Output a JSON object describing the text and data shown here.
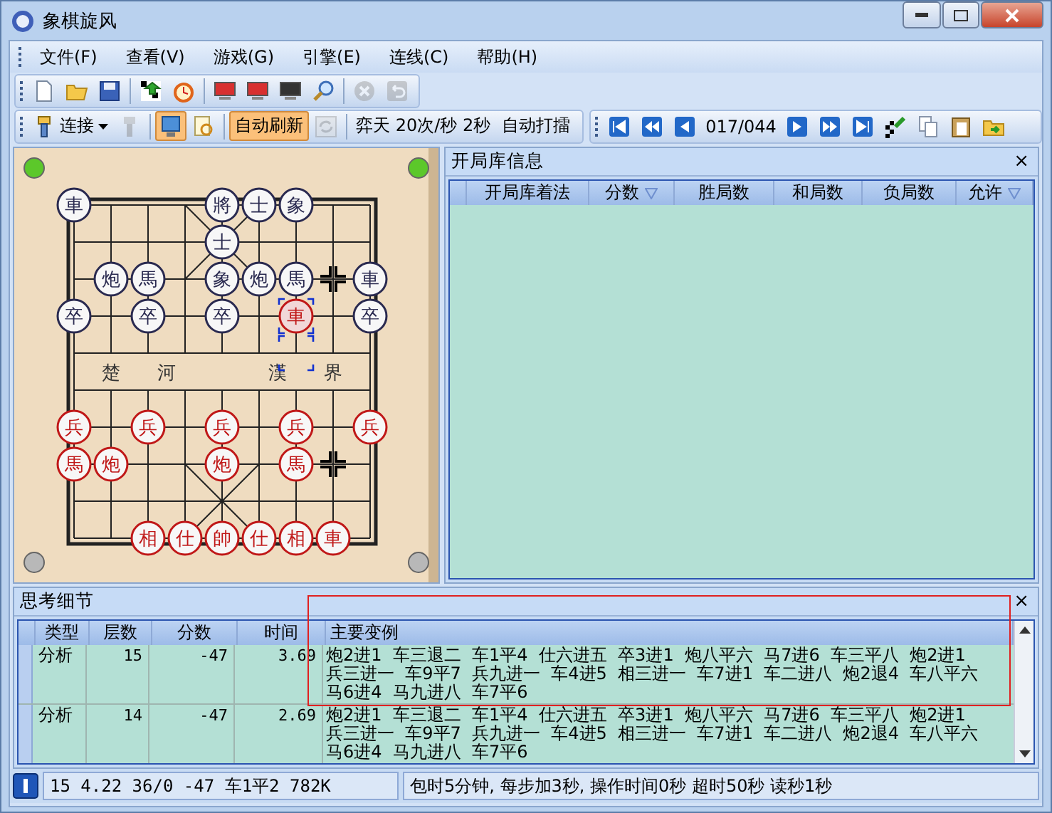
{
  "window": {
    "title": "象棋旋风"
  },
  "menu": [
    "文件(F)",
    "查看(V)",
    "游戏(G)",
    "引擎(E)",
    "连线(C)",
    "帮助(H)"
  ],
  "toolbar_file": [
    {
      "kind": "new",
      "disabled": false
    },
    {
      "kind": "open",
      "disabled": false
    },
    {
      "kind": "save",
      "disabled": false
    },
    {
      "kind": "sep"
    },
    {
      "kind": "swap",
      "disabled": false
    },
    {
      "kind": "clock",
      "disabled": false
    },
    {
      "kind": "sep"
    },
    {
      "kind": "redscreen",
      "disabled": false
    },
    {
      "kind": "redscreen",
      "disabled": false
    },
    {
      "kind": "darkscreen",
      "disabled": false
    },
    {
      "kind": "search",
      "disabled": false
    },
    {
      "kind": "sep"
    },
    {
      "kind": "stop",
      "disabled": true
    },
    {
      "kind": "undo",
      "disabled": true
    }
  ],
  "toolbar_connect": [
    {
      "kind": "plug",
      "disabled": false,
      "pressed": false,
      "label": "连接",
      "dropdown": true
    },
    {
      "kind": "tool",
      "disabled": true,
      "pressed": false
    },
    {
      "kind": "sep"
    },
    {
      "kind": "monitor",
      "disabled": false,
      "pressed": true
    },
    {
      "kind": "finder",
      "disabled": false,
      "pressed": false
    },
    {
      "kind": "sep"
    },
    {
      "kind": "text",
      "label": "自动刷新",
      "pressed": true
    },
    {
      "kind": "refresh",
      "disabled": true,
      "pressed": false
    },
    {
      "kind": "sep"
    },
    {
      "kind": "info",
      "label": "弈天 20次/秒 2秒"
    },
    {
      "kind": "text",
      "label": "自动打擂",
      "pressed": false
    }
  ],
  "toolbar_nav": [
    {
      "kind": "first"
    },
    {
      "kind": "rewind"
    },
    {
      "kind": "prev"
    },
    {
      "kind": "counter",
      "label": "017/044"
    },
    {
      "kind": "next"
    },
    {
      "kind": "forward"
    },
    {
      "kind": "last"
    },
    {
      "kind": "flag"
    },
    {
      "kind": "copy"
    },
    {
      "kind": "paste"
    },
    {
      "kind": "import"
    }
  ],
  "board": {
    "river": [
      "楚",
      "河",
      "漢",
      "界"
    ],
    "ranks": [
      [
        {
          "kind": "black",
          "char": "車",
          "selected": false
        },
        {
          "kind": "empty"
        },
        {
          "kind": "empty"
        },
        {
          "kind": "empty"
        },
        {
          "kind": "black",
          "char": "將",
          "selected": false
        },
        {
          "kind": "black",
          "char": "士",
          "selected": false
        },
        {
          "kind": "black",
          "char": "象",
          "selected": false
        },
        {
          "kind": "empty"
        },
        {
          "kind": "empty"
        }
      ],
      [
        {
          "kind": "empty"
        },
        {
          "kind": "empty"
        },
        {
          "kind": "empty"
        },
        {
          "kind": "empty"
        },
        {
          "kind": "black",
          "char": "士",
          "selected": false
        },
        {
          "kind": "empty"
        },
        {
          "kind": "empty"
        },
        {
          "kind": "empty"
        },
        {
          "kind": "empty"
        }
      ],
      [
        {
          "kind": "empty"
        },
        {
          "kind": "black",
          "char": "炮",
          "selected": false
        },
        {
          "kind": "black",
          "char": "馬",
          "selected": false
        },
        {
          "kind": "empty"
        },
        {
          "kind": "black",
          "char": "象",
          "selected": false
        },
        {
          "kind": "black",
          "char": "炮",
          "selected": false
        },
        {
          "kind": "black",
          "char": "馬",
          "selected": false
        },
        {
          "kind": "cross"
        },
        {
          "kind": "black",
          "char": "車",
          "selected": false
        }
      ],
      [
        {
          "kind": "black",
          "char": "卒",
          "selected": false
        },
        {
          "kind": "empty"
        },
        {
          "kind": "black",
          "char": "卒",
          "selected": false
        },
        {
          "kind": "empty"
        },
        {
          "kind": "black",
          "char": "卒",
          "selected": false
        },
        {
          "kind": "empty"
        },
        {
          "kind": "red",
          "char": "車",
          "selected": true
        },
        {
          "kind": "empty"
        },
        {
          "kind": "black",
          "char": "卒",
          "selected": false
        }
      ],
      [
        {
          "kind": "empty"
        },
        {
          "kind": "empty"
        },
        {
          "kind": "empty"
        },
        {
          "kind": "empty"
        },
        {
          "kind": "empty"
        },
        {
          "kind": "empty"
        },
        {
          "kind": "from"
        },
        {
          "kind": "empty"
        },
        {
          "kind": "empty"
        }
      ],
      [
        {
          "kind": "empty"
        },
        {
          "kind": "empty"
        },
        {
          "kind": "empty"
        },
        {
          "kind": "empty"
        },
        {
          "kind": "empty"
        },
        {
          "kind": "empty"
        },
        {
          "kind": "empty"
        },
        {
          "kind": "empty"
        },
        {
          "kind": "empty"
        }
      ],
      [
        {
          "kind": "red",
          "char": "兵",
          "selected": false
        },
        {
          "kind": "empty"
        },
        {
          "kind": "red",
          "char": "兵",
          "selected": false
        },
        {
          "kind": "empty"
        },
        {
          "kind": "red",
          "char": "兵",
          "selected": false
        },
        {
          "kind": "empty"
        },
        {
          "kind": "red",
          "char": "兵",
          "selected": false
        },
        {
          "kind": "empty"
        },
        {
          "kind": "red",
          "char": "兵",
          "selected": false
        }
      ],
      [
        {
          "kind": "red",
          "char": "馬",
          "selected": false
        },
        {
          "kind": "red",
          "char": "炮",
          "selected": false
        },
        {
          "kind": "empty"
        },
        {
          "kind": "empty"
        },
        {
          "kind": "red",
          "char": "炮",
          "selected": false
        },
        {
          "kind": "empty"
        },
        {
          "kind": "red",
          "char": "馬",
          "selected": false
        },
        {
          "kind": "cross"
        },
        {
          "kind": "empty"
        }
      ],
      [
        {
          "kind": "empty"
        },
        {
          "kind": "empty"
        },
        {
          "kind": "empty"
        },
        {
          "kind": "empty"
        },
        {
          "kind": "empty"
        },
        {
          "kind": "empty"
        },
        {
          "kind": "empty"
        },
        {
          "kind": "empty"
        },
        {
          "kind": "empty"
        }
      ],
      [
        {
          "kind": "empty"
        },
        {
          "kind": "empty"
        },
        {
          "kind": "red",
          "char": "相",
          "selected": false
        },
        {
          "kind": "red",
          "char": "仕",
          "selected": false
        },
        {
          "kind": "red",
          "char": "帥",
          "selected": false
        },
        {
          "kind": "red",
          "char": "仕",
          "selected": false
        },
        {
          "kind": "red",
          "char": "相",
          "selected": false
        },
        {
          "kind": "red",
          "char": "車",
          "selected": false
        },
        {
          "kind": "empty"
        }
      ]
    ],
    "lights": [
      {
        "on": true
      },
      {
        "on": true
      },
      {
        "on": false
      },
      {
        "on": false
      }
    ]
  },
  "book_panel": {
    "title": "开局库信息",
    "close": "×",
    "columns": [
      {
        "label": "开局库着法",
        "filter": false
      },
      {
        "label": "分数",
        "filter": true
      },
      {
        "label": "胜局数",
        "filter": false
      },
      {
        "label": "和局数",
        "filter": false
      },
      {
        "label": "负局数",
        "filter": false
      },
      {
        "label": "允许",
        "filter": true
      }
    ]
  },
  "think_panel": {
    "title": "思考细节",
    "close": "×",
    "columns": [
      "类型",
      "层数",
      "分数",
      "时间",
      "主要变例"
    ],
    "rows": [
      {
        "type": "分析",
        "depth": "15",
        "score": "-47",
        "time": "3.69",
        "pv": [
          "炮2进1  车三退二  车1平4  仕六进五  卒3进1  炮八平六  马7进6  车三平八  炮2进1",
          "兵三进一  车9平7  兵九进一  车4进5  相三进一  车7进1  车二进八  炮2退4  车八平六",
          "马6进4  马九进八  车7平6"
        ]
      },
      {
        "type": "分析",
        "depth": "14",
        "score": "-47",
        "time": "2.69",
        "pv": [
          "炮2进1  车三退二  车1平4  仕六进五  卒3进1  炮八平六  马7进6  车三平八  炮2进1",
          "兵三进一  车9平7  兵九进一  车4进5  相三进一  车7进1  车二进八  炮2退4  车八平六",
          "马6进4  马九进八  车7平6"
        ]
      }
    ]
  },
  "annotation": {
    "kind": "rectangle"
  },
  "status_bar": {
    "engine": "15 4.22 36/0 -47 车1平2 782K",
    "clock": "包时5分钟, 每步加3秒, 操作时间0秒  超时50秒  读秒1秒"
  }
}
